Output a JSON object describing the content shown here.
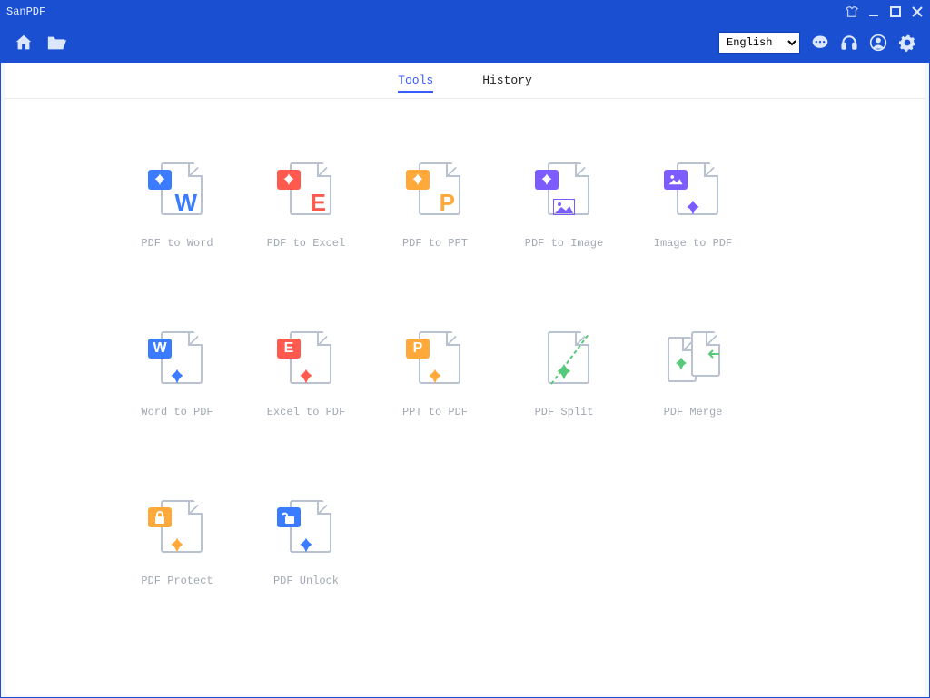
{
  "app": {
    "title": "SanPDF"
  },
  "language": {
    "selected": "English",
    "options": [
      "English"
    ]
  },
  "tabs": [
    {
      "id": "tools",
      "label": "Tools",
      "active": true
    },
    {
      "id": "history",
      "label": "History",
      "active": false
    }
  ],
  "tools": [
    {
      "id": "pdf-to-word",
      "label": "PDF to Word"
    },
    {
      "id": "pdf-to-excel",
      "label": "PDF to Excel"
    },
    {
      "id": "pdf-to-ppt",
      "label": "PDF to PPT"
    },
    {
      "id": "pdf-to-image",
      "label": "PDF to Image"
    },
    {
      "id": "image-to-pdf",
      "label": "Image to PDF"
    },
    {
      "id": "word-to-pdf",
      "label": "Word to PDF"
    },
    {
      "id": "excel-to-pdf",
      "label": "Excel to PDF"
    },
    {
      "id": "ppt-to-pdf",
      "label": "PPT to PDF"
    },
    {
      "id": "pdf-split",
      "label": "PDF Split"
    },
    {
      "id": "pdf-merge",
      "label": "PDF Merge"
    },
    {
      "id": "pdf-protect",
      "label": "PDF Protect"
    },
    {
      "id": "pdf-unlock",
      "label": "PDF Unlock"
    }
  ],
  "colors": {
    "word": "#3a7bff",
    "excel": "#ff5a4d",
    "ppt": "#ffa93b",
    "image": "#7c5bff",
    "split": "#57c97a",
    "protect": "#ffa93b",
    "unlock": "#3a7bff"
  }
}
